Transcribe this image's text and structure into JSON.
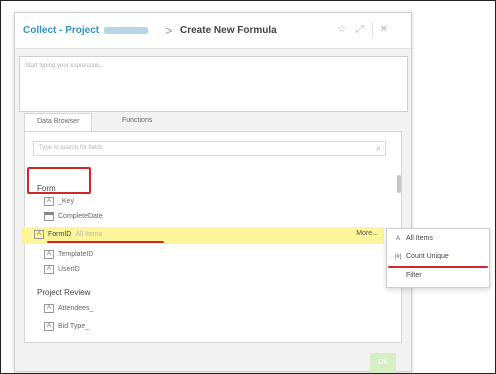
{
  "dialog": {
    "breadcrumb_app": "Collect - Project",
    "breadcrumb_separator": ">",
    "title": "Create New Formula",
    "icons": {
      "star": "star-icon",
      "expand": "expand-icon",
      "close": "close-icon"
    }
  },
  "expression": {
    "placeholder": "Start typing your expression..."
  },
  "tabs": [
    {
      "label": "Data Browser",
      "active": true
    },
    {
      "label": "Functions",
      "active": false
    }
  ],
  "search": {
    "placeholder": "Type to search for fields"
  },
  "groups": [
    {
      "label": "Form"
    },
    {
      "label": "Project Review"
    }
  ],
  "form_fields": [
    {
      "label": "_Key",
      "icon": "text-field-icon",
      "glyph": "A"
    },
    {
      "label": "CompleteDate",
      "icon": "calendar-icon",
      "glyph": ""
    },
    {
      "label": "FormID",
      "icon": "text-field-icon",
      "glyph": "A",
      "selected_sub": "All Items",
      "more_label": "More..."
    },
    {
      "label": "TemplateID",
      "icon": "text-field-icon",
      "glyph": "A"
    },
    {
      "label": "UserID",
      "icon": "text-field-icon",
      "glyph": "A"
    }
  ],
  "review_fields": [
    {
      "label": "Attendees_",
      "icon": "text-field-icon",
      "glyph": "A"
    },
    {
      "label": "Bid Type_",
      "icon": "text-field-icon",
      "glyph": "A"
    }
  ],
  "context_menu": [
    {
      "label": "All Items",
      "icon": "letter-a-icon",
      "glyph": "A"
    },
    {
      "label": "Count Unique",
      "icon": "count-unique-icon",
      "glyph": "|#|"
    },
    {
      "label": "Filter",
      "icon": "",
      "glyph": ""
    }
  ],
  "ok_button": {
    "label": "OK"
  },
  "colors": {
    "accent": "#2f93c9",
    "highlight": "#fdf59a",
    "annotation": "#d0262c",
    "ok_disabled": "#d6efc4"
  }
}
